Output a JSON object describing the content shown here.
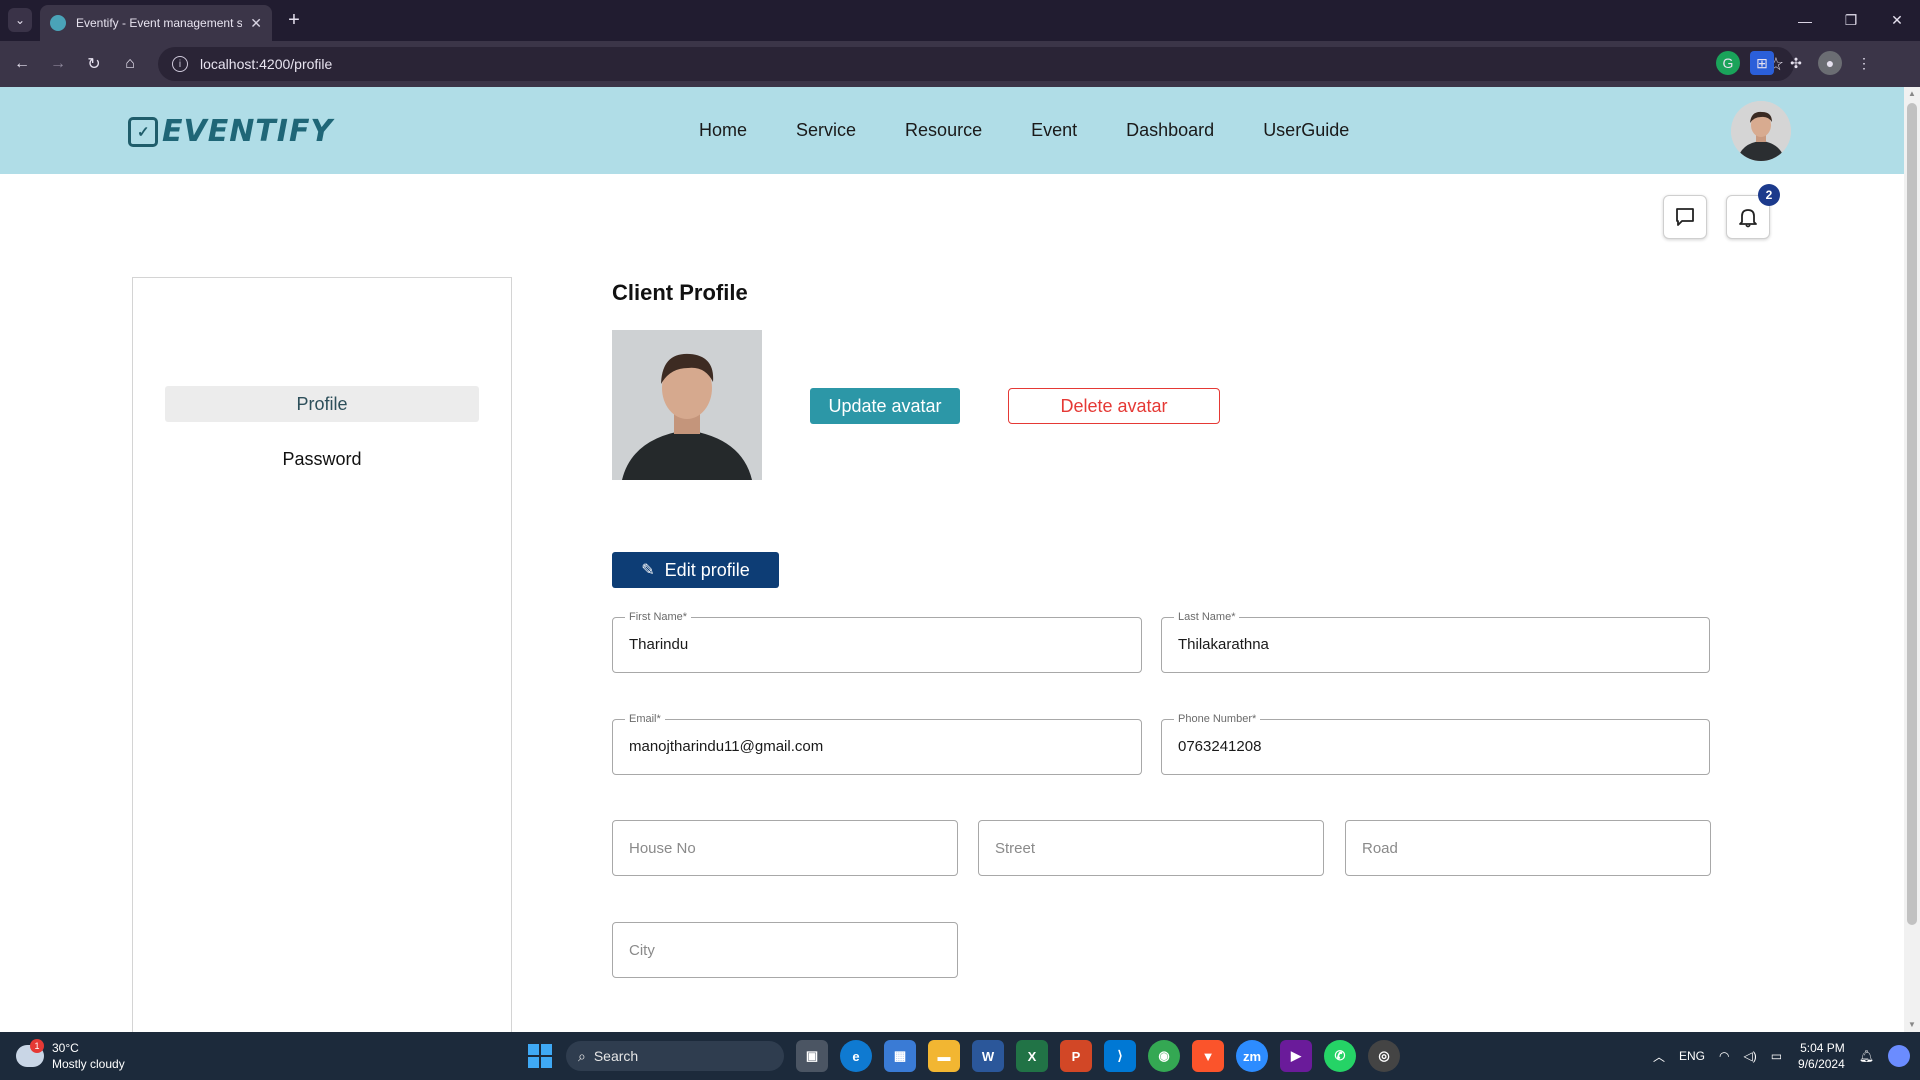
{
  "browser": {
    "tab_title": "Eventify - Event management sy",
    "url": "localhost:4200/profile"
  },
  "site": {
    "logo_text": "EVENTIFY",
    "nav": [
      "Home",
      "Service",
      "Resource",
      "Event",
      "Dashboard",
      "UserGuide"
    ],
    "notification_count": "2"
  },
  "sidebar": {
    "items": [
      {
        "label": "Profile",
        "active": true
      },
      {
        "label": "Password",
        "active": false
      }
    ]
  },
  "profile": {
    "title": "Client Profile",
    "update_avatar_label": "Update avatar",
    "delete_avatar_label": "Delete avatar",
    "edit_profile_label": "Edit profile",
    "fields": {
      "first_name": {
        "label": "First Name*",
        "value": "Tharindu"
      },
      "last_name": {
        "label": "Last Name*",
        "value": "Thilakarathna"
      },
      "email": {
        "label": "Email*",
        "value": "manojtharindu11@gmail.com"
      },
      "phone": {
        "label": "Phone Number*",
        "value": "0763241208"
      },
      "house_no": {
        "placeholder": "House No"
      },
      "street": {
        "placeholder": "Street"
      },
      "road": {
        "placeholder": "Road"
      },
      "city": {
        "placeholder": "City"
      }
    }
  },
  "taskbar": {
    "temperature": "30°C",
    "weather": "Mostly cloudy",
    "weather_badge": "1",
    "search_label": "Search",
    "language": "ENG",
    "time": "5:04 PM",
    "date": "9/6/2024"
  },
  "colors": {
    "header_bg": "#b0dde7",
    "update_button": "#2c97a7",
    "delete_button": "#e53935",
    "edit_button": "#0d3d75",
    "badge": "#1c3a8c"
  }
}
